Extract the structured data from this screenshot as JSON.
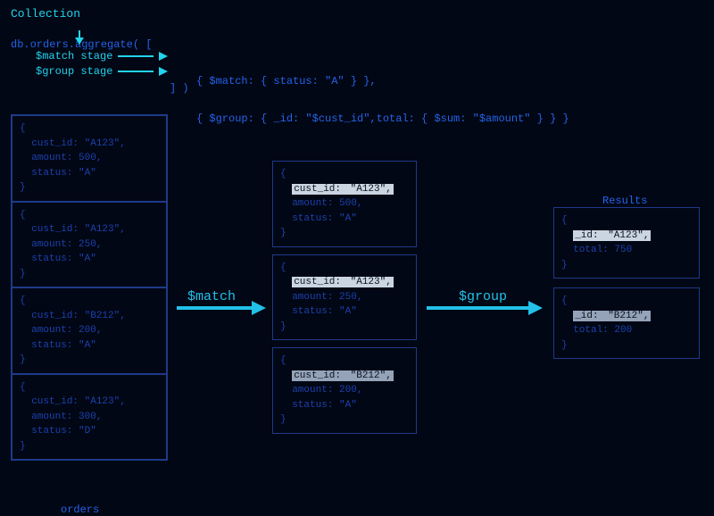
{
  "header": {
    "collection_label": "Collection",
    "aggregate_line": "db.orders.aggregate( [",
    "close_line": "] )"
  },
  "annotations": {
    "match_label": "$match stage",
    "group_label": "$group stage",
    "match_code": "{ $match: { status: \"A\" } },",
    "group_code": "{ $group: { _id: \"$cust_id\",total: { $sum: \"$amount\" } } }"
  },
  "arrows": {
    "match": "$match",
    "group": "$group"
  },
  "orders_label": "orders",
  "results_label": "Results",
  "orders_docs": [
    "{\n  cust_id: \"A123\",\n  amount: 500,\n  status: \"A\"\n}",
    "{\n  cust_id: \"A123\",\n  amount: 250,\n  status: \"A\"\n}",
    "{\n  cust_id: \"B212\",\n  amount: 200,\n  status: \"A\"\n}",
    "{\n  cust_id: \"A123\",\n  amount: 300,\n  status: \"D\"\n}"
  ],
  "match_docs": [
    {
      "open": "{",
      "k": "cust_id:",
      "v": " \"A123\",",
      "rest": "\n  amount: 500,\n  status: \"A\"\n}",
      "hl": "light"
    },
    {
      "open": "{",
      "k": "cust_id:",
      "v": " \"A123\",",
      "rest": "\n  amount: 250,\n  status: \"A\"\n}",
      "hl": "light"
    },
    {
      "open": "{",
      "k": "cust_id:",
      "v": " \"B212\",",
      "rest": "\n  amount: 200,\n  status: \"A\"\n}",
      "hl": "gray"
    }
  ],
  "results_docs": [
    {
      "open": "{",
      "k": "_id:",
      "v": " \"A123\",",
      "rest": "\n  total: 750\n}",
      "hl": "light"
    },
    {
      "open": "{",
      "k": "_id:",
      "v": " \"B212\",",
      "rest": "\n  total: 200\n}",
      "hl": "gray"
    }
  ]
}
